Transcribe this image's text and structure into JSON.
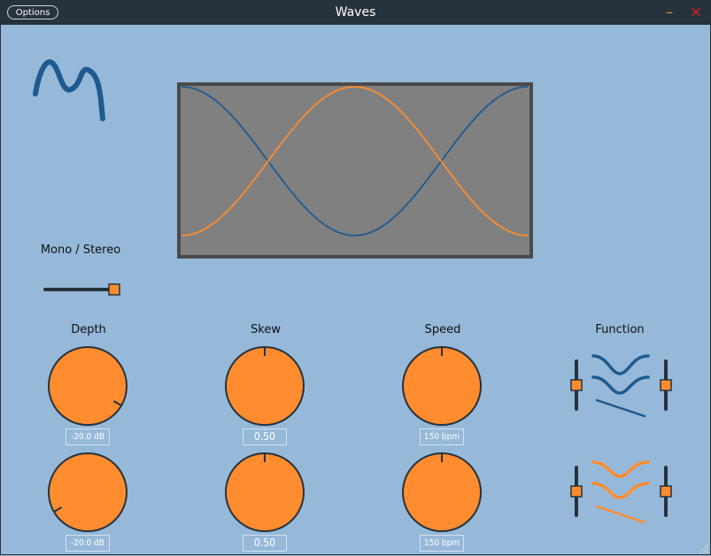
{
  "window": {
    "title": "Waves",
    "options_label": "Options",
    "minimize_glyph": "–",
    "close_glyph": "✕"
  },
  "colors": {
    "background": "#96b9d9",
    "titlebar": "#27323d",
    "accent": "#ff8c2e",
    "wave_blue": "#1f5a8f",
    "display_bg": "#808080",
    "display_border": "#4a4a4a",
    "minimize": "#e8920c",
    "close": "#d11f1f"
  },
  "mode": {
    "label": "Mono / Stereo",
    "value": 1.0
  },
  "controls": {
    "depth": {
      "label": "Depth"
    },
    "skew": {
      "label": "Skew"
    },
    "speed": {
      "label": "Speed"
    },
    "function": {
      "label": "Function"
    }
  },
  "rows": [
    {
      "depth": {
        "display": "-20.0 dB",
        "level": 0.9
      },
      "skew": {
        "display": "0.50",
        "level": 0.5
      },
      "speed": {
        "display": "150 bpm",
        "level": 0.5
      },
      "function_left_slider": 0.5,
      "function_right_slider": 0.5,
      "color": "#1f5a8f"
    },
    {
      "depth": {
        "display": "-20.0 dB",
        "level": 0.1
      },
      "skew": {
        "display": "0.50",
        "level": 0.5
      },
      "speed": {
        "display": "150 bpm",
        "level": 0.5
      },
      "function_left_slider": 0.5,
      "function_right_slider": 0.5,
      "color": "#ff8c2e"
    }
  ],
  "icons": {
    "logo": "waves-logo-icon",
    "resize": "resize-grip-icon"
  }
}
